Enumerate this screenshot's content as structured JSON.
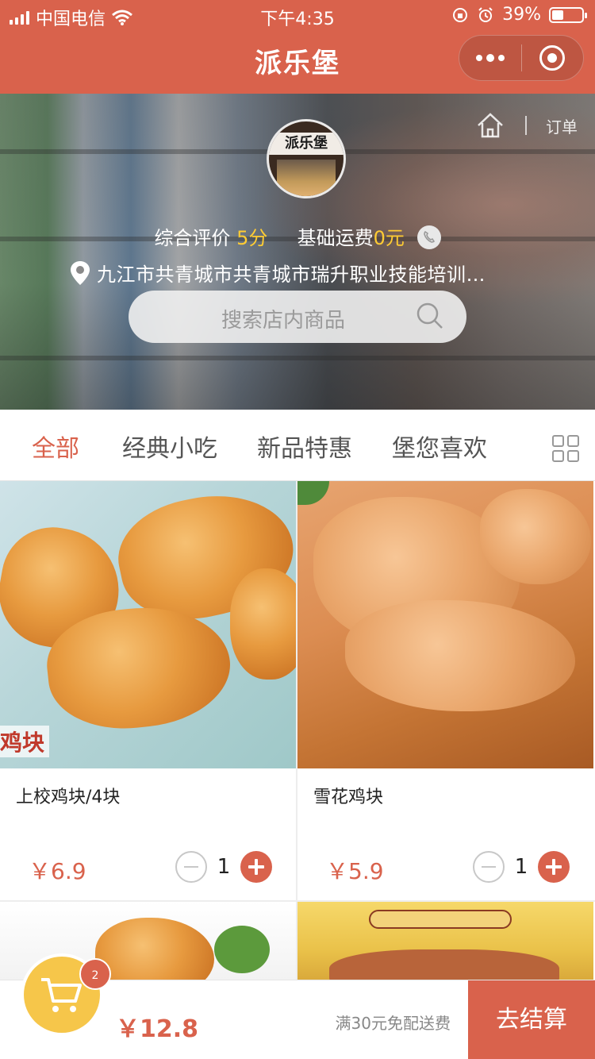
{
  "status_bar": {
    "carrier": "中国电信",
    "time": "下午4:35",
    "battery_text": "39%",
    "battery_level": 0.39
  },
  "nav": {
    "title": "派乐堡"
  },
  "store": {
    "sign_text": "派乐堡",
    "rating_label": "综合评价",
    "rating_value": "5分",
    "delivery_label": "基础运费",
    "delivery_value": "0元",
    "address": "九江市共青城市共青城市瑞升职业技能培训…",
    "order_link": "订单",
    "search_placeholder": "搜索店内商品"
  },
  "tabs": [
    {
      "label": "全部",
      "active": true
    },
    {
      "label": "经典小吃",
      "active": false
    },
    {
      "label": "新品特惠",
      "active": false
    },
    {
      "label": "堡您喜欢",
      "active": false
    }
  ],
  "products": [
    {
      "name": "上校鸡块/4块",
      "price": "￥6.9",
      "qty": "1",
      "image_label": "鸡块"
    },
    {
      "name": "雪花鸡块",
      "price": "￥5.9",
      "qty": "1"
    }
  ],
  "bottom": {
    "cart_count": "2",
    "total": "￥12.8",
    "free_shipping": "满30元免配送费",
    "checkout": "去结算"
  },
  "colors": {
    "accent": "#d9624c",
    "highlight": "#ffcc33",
    "cart": "#f6c64a"
  }
}
